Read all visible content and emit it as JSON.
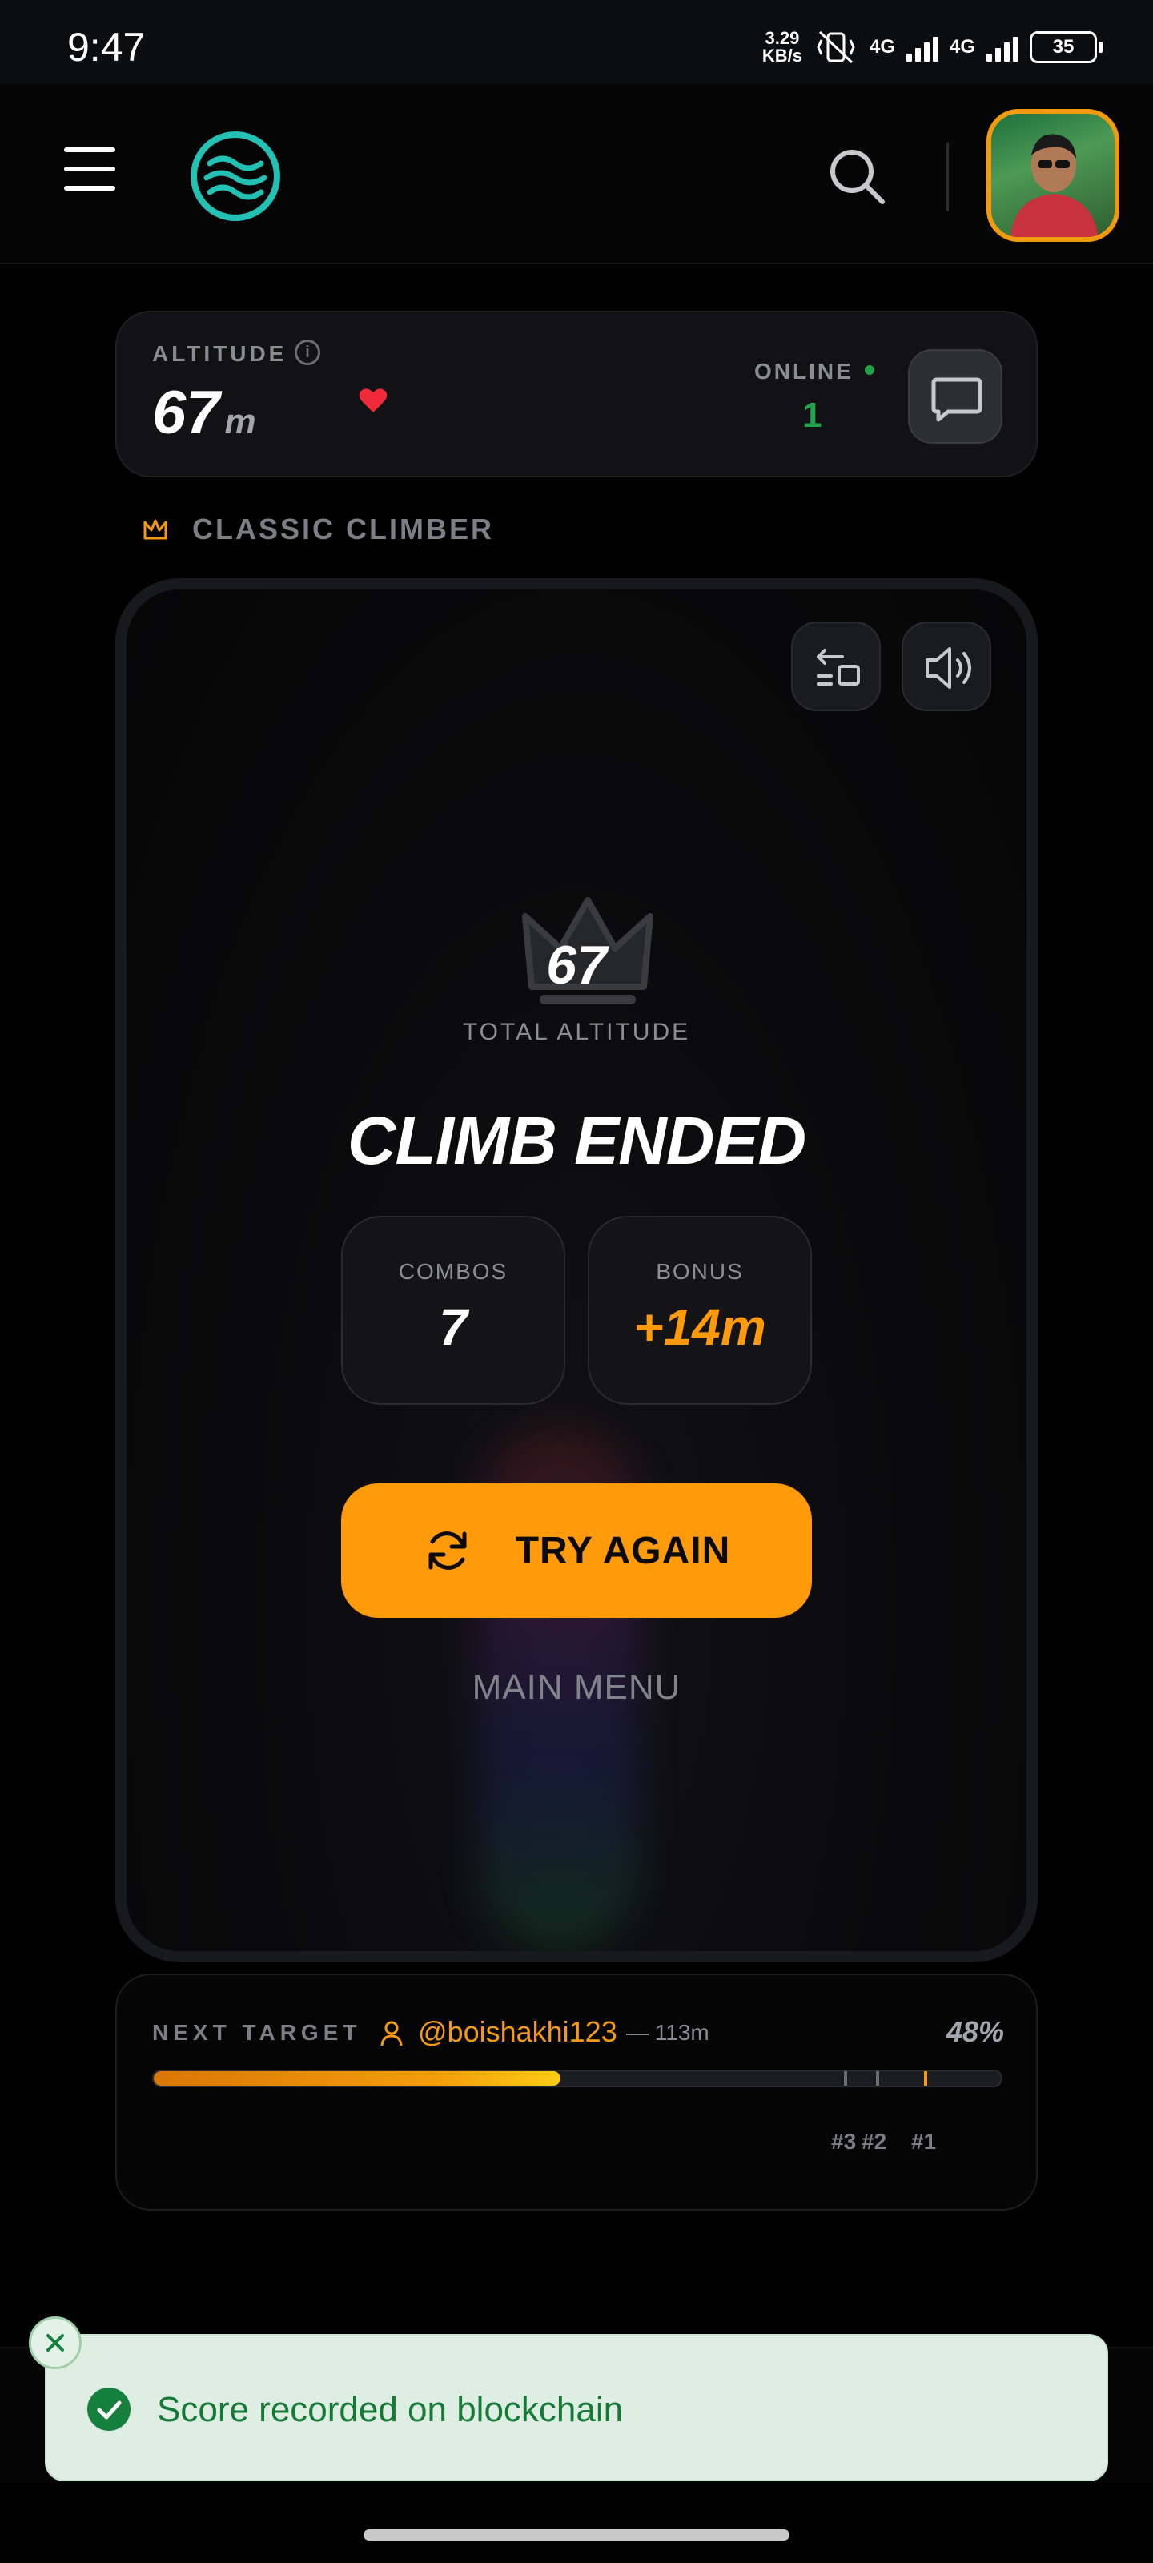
{
  "status_bar": {
    "time": "9:47",
    "speed_value": "3.29",
    "speed_unit": "KB/s",
    "network_1": "4G",
    "network_2": "4G",
    "battery": "35"
  },
  "header": {
    "menu_icon": "hamburger-icon",
    "logo_icon": "wave-logo-icon",
    "search_icon": "search-icon"
  },
  "altitude_card": {
    "label": "ALTITUDE",
    "value": "67",
    "unit": "m",
    "online_label": "ONLINE",
    "online_count": "1",
    "status_color": "#22a34a"
  },
  "mode": {
    "label": "CLASSIC CLIMBER",
    "icon": "crown-icon"
  },
  "game": {
    "total_altitude": "67",
    "total_label": "TOTAL ALTITUDE",
    "title": "CLIMB ENDED",
    "stats": [
      {
        "label": "COMBOS",
        "value": "7",
        "color": "#ffffff"
      },
      {
        "label": "BONUS",
        "value": "+14m",
        "color": "#ff9a0b"
      }
    ],
    "try_again_label": "TRY AGAIN",
    "main_menu_label": "MAIN MENU",
    "accent_color": "#ff9a0b"
  },
  "next_target": {
    "label": "NEXT TARGET",
    "username": "@boishakhi123",
    "distance": "— 113m",
    "percent_text": "48%",
    "progress": 0.48,
    "ranks": [
      "#3",
      "#2",
      "#1"
    ]
  },
  "toast": {
    "message": "Score recorded on blockchain",
    "color": "#157a36"
  }
}
